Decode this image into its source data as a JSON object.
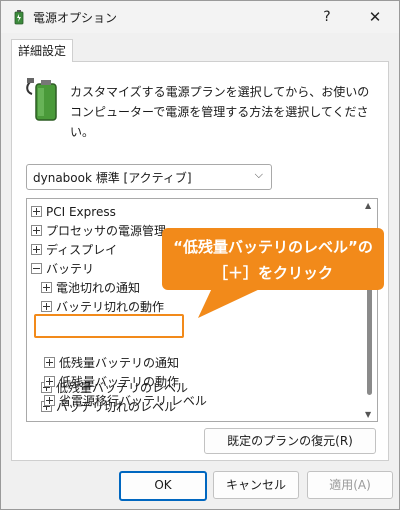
{
  "window": {
    "title": "電源オプション",
    "help_label": "?",
    "close_label": "✕"
  },
  "tab": {
    "label": "詳細設定"
  },
  "description": "カスタマイズする電源プランを選択してから、お使いのコンピューターで電源を管理する方法を選択してください。",
  "plan_select": {
    "value": "dynabook 標準 [アクティブ]"
  },
  "tree": {
    "items": [
      {
        "label": "PCI Express",
        "expander": "plus"
      },
      {
        "label": "プロセッサの電源管理",
        "expander": "plus"
      },
      {
        "label": "ディスプレイ",
        "expander": "plus"
      },
      {
        "label": "バッテリ",
        "expander": "minus"
      },
      {
        "label": "電池切れの通知",
        "expander": "plus"
      },
      {
        "label": "バッテリ切れの動作",
        "expander": "plus"
      },
      {
        "label": "低残量バッテリのレベル",
        "expander": "plus",
        "highlighted": true
      },
      {
        "label": "バッテリ切れのレベル",
        "expander": "plus"
      },
      {
        "label": "低残量バッテリの通知",
        "expander": "plus"
      },
      {
        "label": "低残量バッテリの動作",
        "expander": "plus"
      },
      {
        "label": "省電源移行バッテリ レベル",
        "expander": "plus"
      }
    ]
  },
  "restore_button": {
    "label": "既定のプランの復元(R)"
  },
  "buttons": {
    "ok": "OK",
    "cancel": "キャンセル",
    "apply": "適用(A)"
  },
  "callout": {
    "line1": "“低残量バッテリのレベル”の",
    "line2": "［＋］をクリック"
  },
  "colors": {
    "callout": "#f28a1a",
    "ok_border": "#0067c0"
  }
}
